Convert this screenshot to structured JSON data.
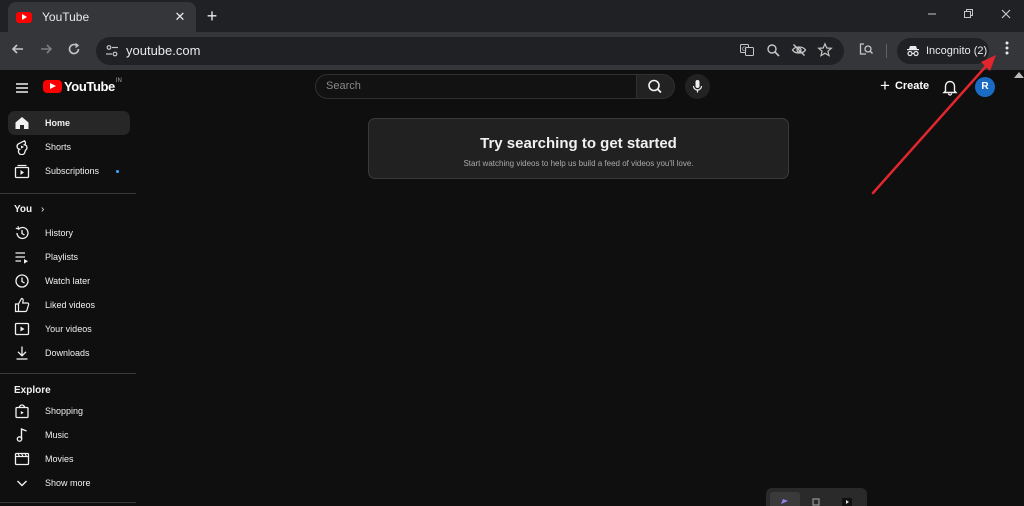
{
  "browser": {
    "tab_title": "YouTube",
    "tab_close": "✕",
    "new_tab": "+",
    "url": "youtube.com",
    "incognito_label": "Incognito (2)"
  },
  "youtube": {
    "logo_text": "YouTube",
    "country_code": "IN",
    "search_placeholder": "Search",
    "create_label": "Create",
    "avatar_initial": "R",
    "sidebar": {
      "main": [
        "Home",
        "Shorts",
        "Subscriptions"
      ],
      "you_header": "You",
      "you_items": [
        "History",
        "Playlists",
        "Watch later",
        "Liked videos",
        "Your videos",
        "Downloads"
      ],
      "explore_header": "Explore",
      "explore_items": [
        "Shopping",
        "Music",
        "Movies",
        "Show more"
      ]
    },
    "prompt": {
      "heading": "Try searching to get started",
      "subtext": "Start watching videos to help us build a feed of videos you'll love."
    }
  },
  "colors": {
    "yt_red": "#ff0000",
    "accent_blue": "#3ea6ff",
    "avatar_blue": "#1a6bc4",
    "annotation_red": "#e3262e"
  }
}
